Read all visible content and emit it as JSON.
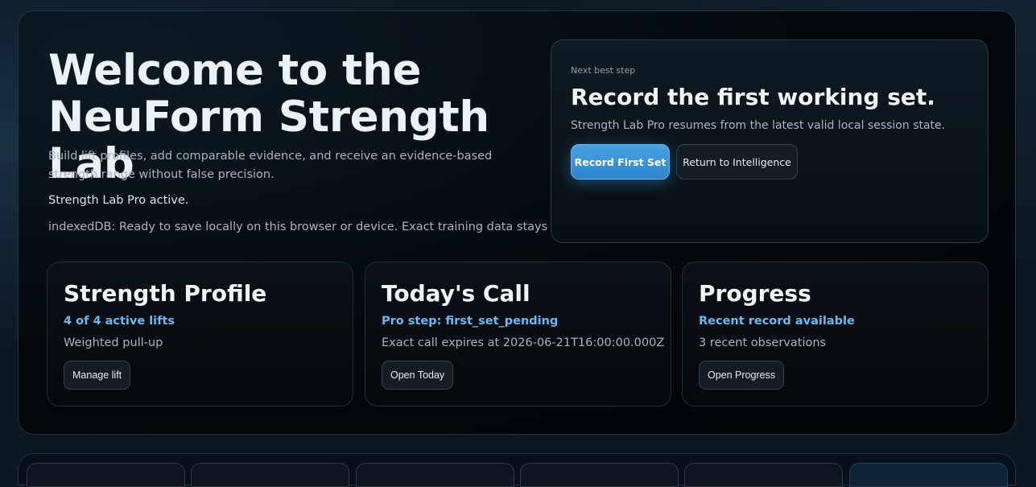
{
  "hero": {
    "title": "Welcome to the NeuForm Strength Lab",
    "subtitle": "Build lift profiles, add comparable evidence, and receive an evidence-based strength range without false precision.",
    "status": "Strength Lab Pro active.",
    "storage": "indexedDB: Ready to save locally on this browser or device. Exact training data stays local."
  },
  "next_step": {
    "kicker": "Next best step",
    "title": "Record the first working set.",
    "description": "Strength Lab Pro resumes from the latest valid local session state.",
    "primary_label": "Record First Set",
    "secondary_label": "Return to Intelligence"
  },
  "cards": [
    {
      "title": "Strength Profile",
      "accent": "4 of 4 active lifts",
      "detail": "Weighted pull-up",
      "button": "Manage lift"
    },
    {
      "title": "Today's Call",
      "accent": "Pro step: first_set_pending",
      "detail": "Exact call expires at 2026-06-21T16:00:00.000Z",
      "button": "Open Today"
    },
    {
      "title": "Progress",
      "accent": "Recent record available",
      "detail": "3 recent observations",
      "button": "Open Progress"
    }
  ],
  "colors": {
    "accent": "#6cb8ef",
    "primary_button": "#3a93d8",
    "background": "#03080c"
  }
}
